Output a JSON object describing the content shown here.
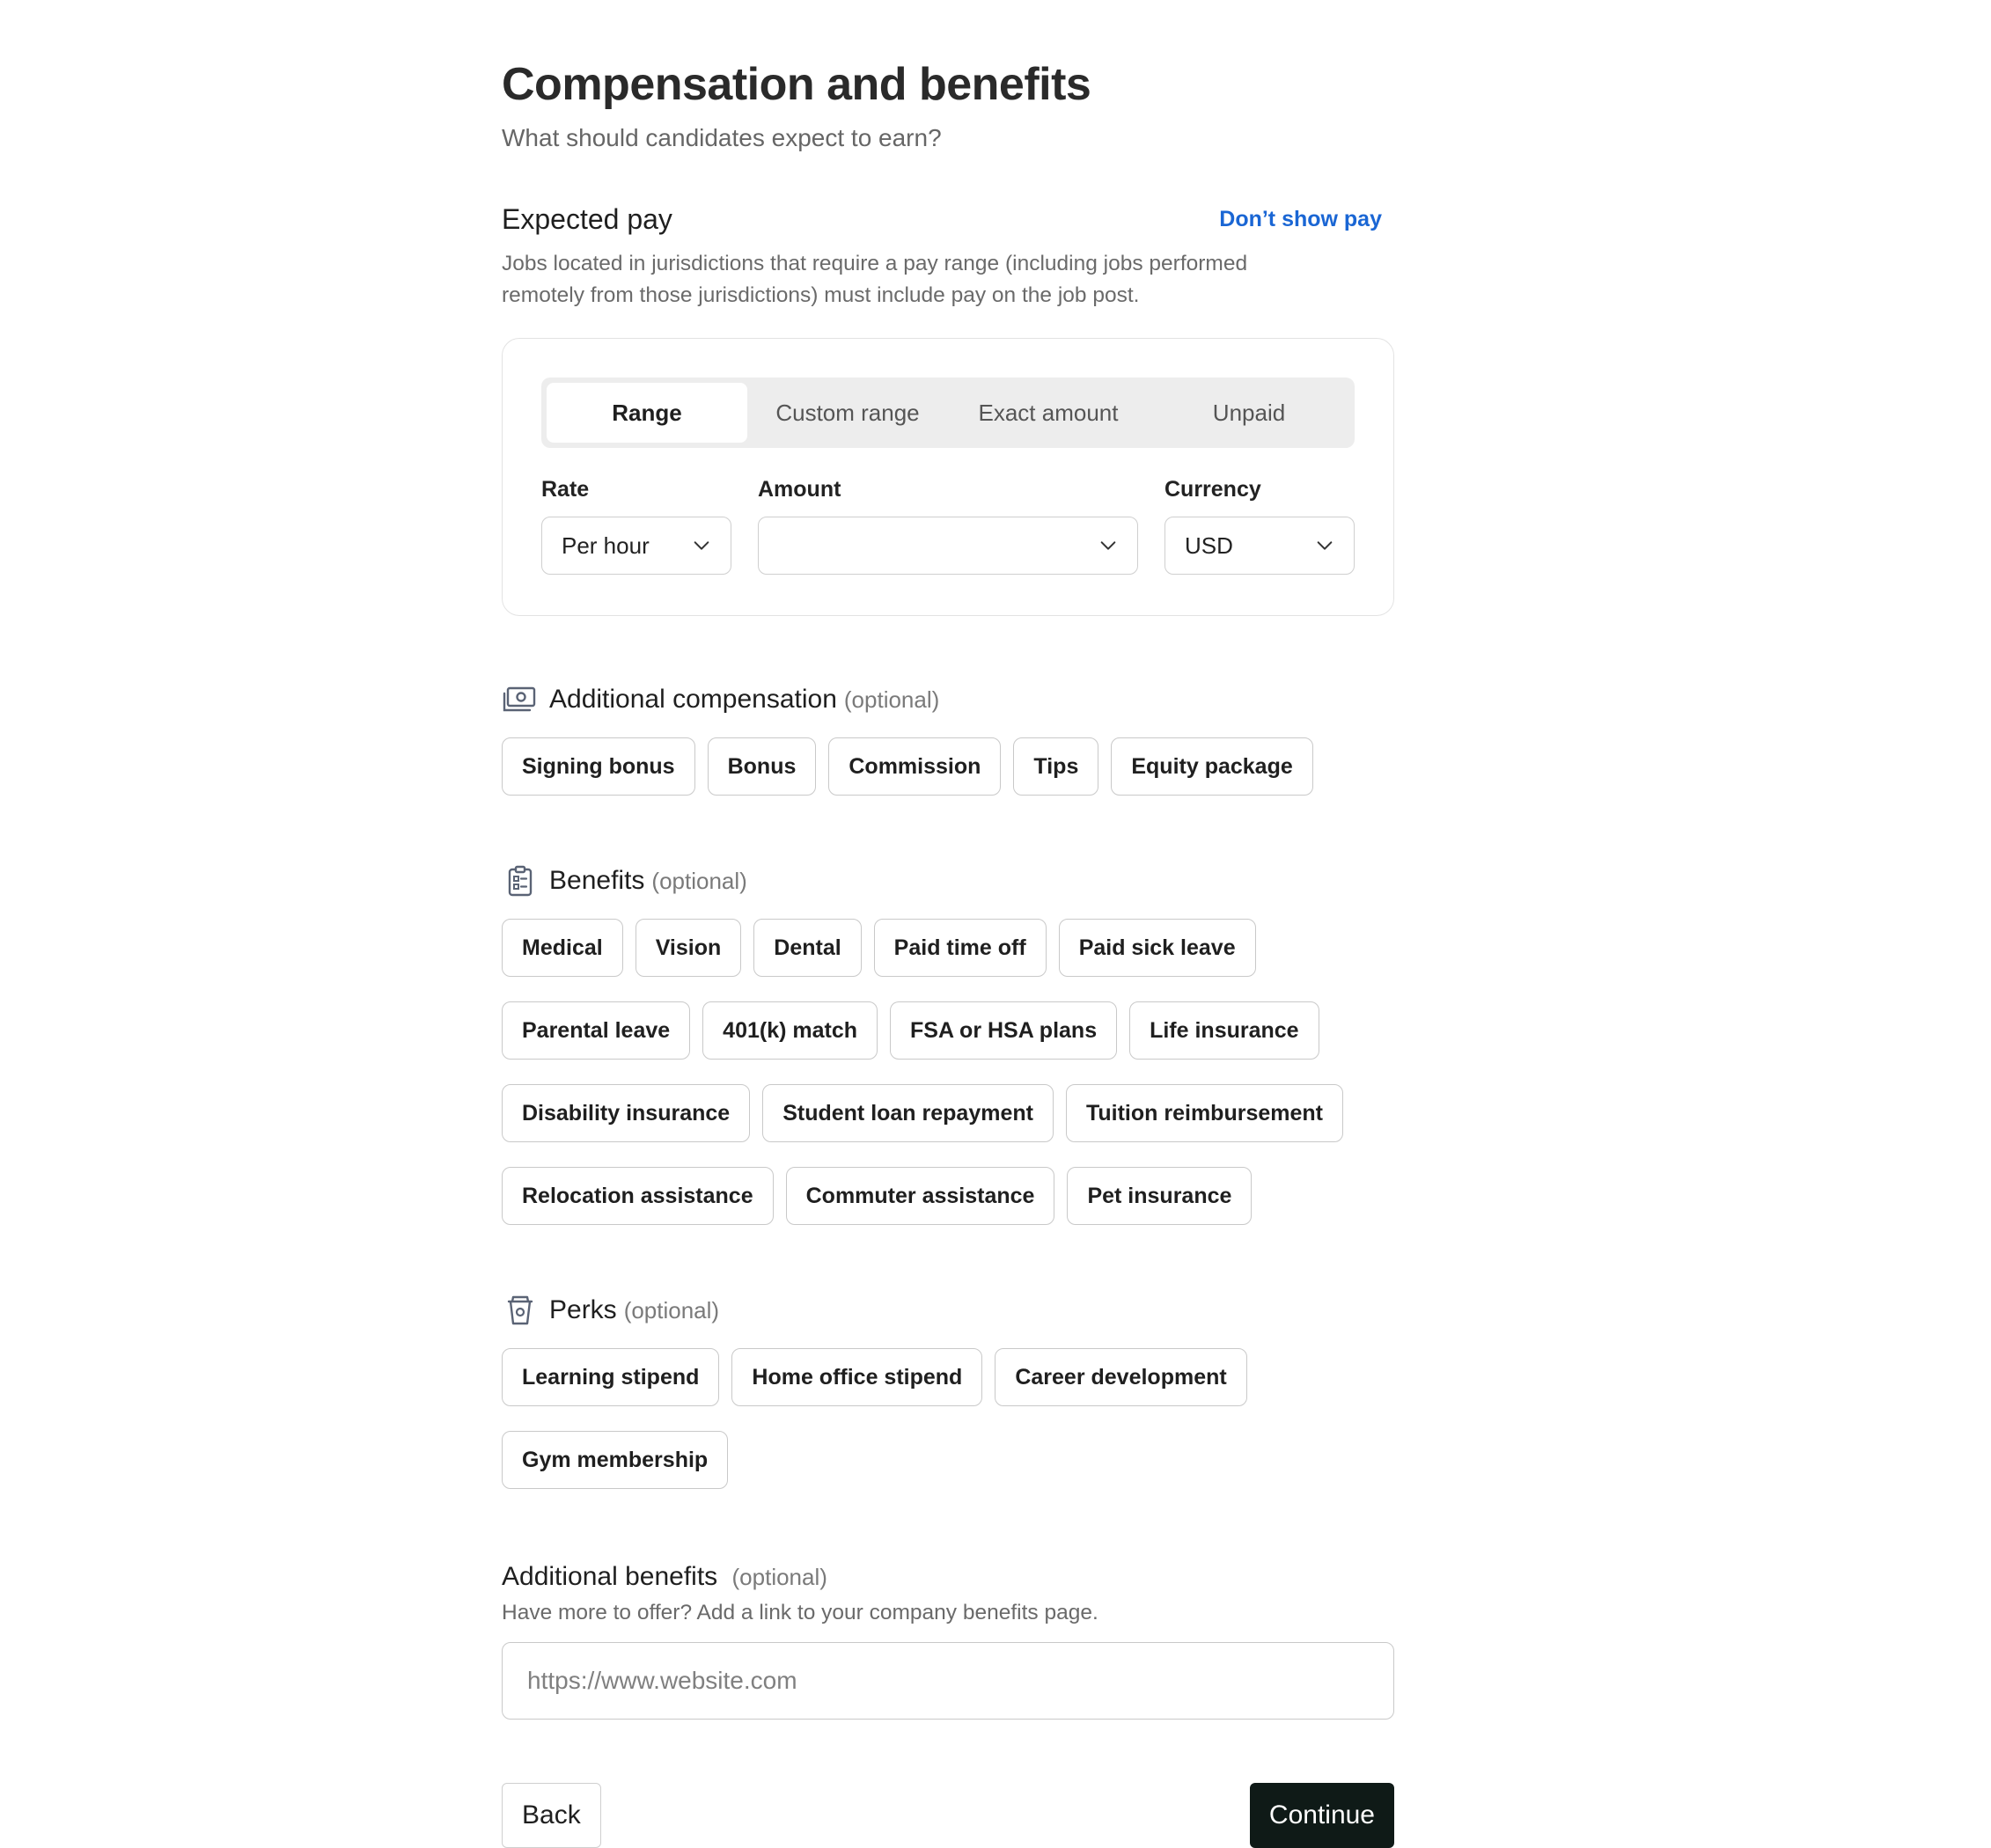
{
  "header": {
    "title": "Compensation and benefits",
    "subtitle": "What should candidates expect to earn?"
  },
  "expected_pay": {
    "title": "Expected pay",
    "hide_link": "Don’t show pay",
    "helper": "Jobs located in jurisdictions that require a pay range (including jobs performed remotely from those jurisdictions) must include pay on the job post.",
    "tabs": [
      {
        "label": "Range",
        "active": true
      },
      {
        "label": "Custom range",
        "active": false
      },
      {
        "label": "Exact amount",
        "active": false
      },
      {
        "label": "Unpaid",
        "active": false
      }
    ],
    "rate": {
      "label": "Rate",
      "value": "Per hour"
    },
    "amount": {
      "label": "Amount",
      "value": ""
    },
    "currency": {
      "label": "Currency",
      "value": "USD"
    }
  },
  "additional_compensation": {
    "title": "Additional compensation",
    "optional": "(optional)",
    "icon": "money-icon",
    "options": [
      "Signing bonus",
      "Bonus",
      "Commission",
      "Tips",
      "Equity package"
    ]
  },
  "benefits": {
    "title": "Benefits",
    "optional": "(optional)",
    "icon": "clipboard-icon",
    "options": [
      "Medical",
      "Vision",
      "Dental",
      "Paid time off",
      "Paid sick leave",
      "Parental leave",
      "401(k) match",
      "FSA or HSA plans",
      "Life insurance",
      "Disability insurance",
      "Student loan repayment",
      "Tuition reimbursement",
      "Relocation assistance",
      "Commuter assistance",
      "Pet insurance"
    ]
  },
  "perks": {
    "title": "Perks",
    "optional": "(optional)",
    "icon": "coffee-cup-icon",
    "options": [
      "Learning stipend",
      "Home office stipend",
      "Career development",
      "Gym membership"
    ]
  },
  "additional_benefits": {
    "title": "Additional benefits",
    "optional": "(optional)",
    "helper": "Have more to offer? Add a link to your company benefits page.",
    "placeholder": "https://www.website.com",
    "value": ""
  },
  "actions": {
    "back": "Back",
    "continue": "Continue"
  },
  "colors": {
    "link": "#1a66d4",
    "primary_button": "#0f1a17",
    "segment_bg": "#ededed"
  }
}
